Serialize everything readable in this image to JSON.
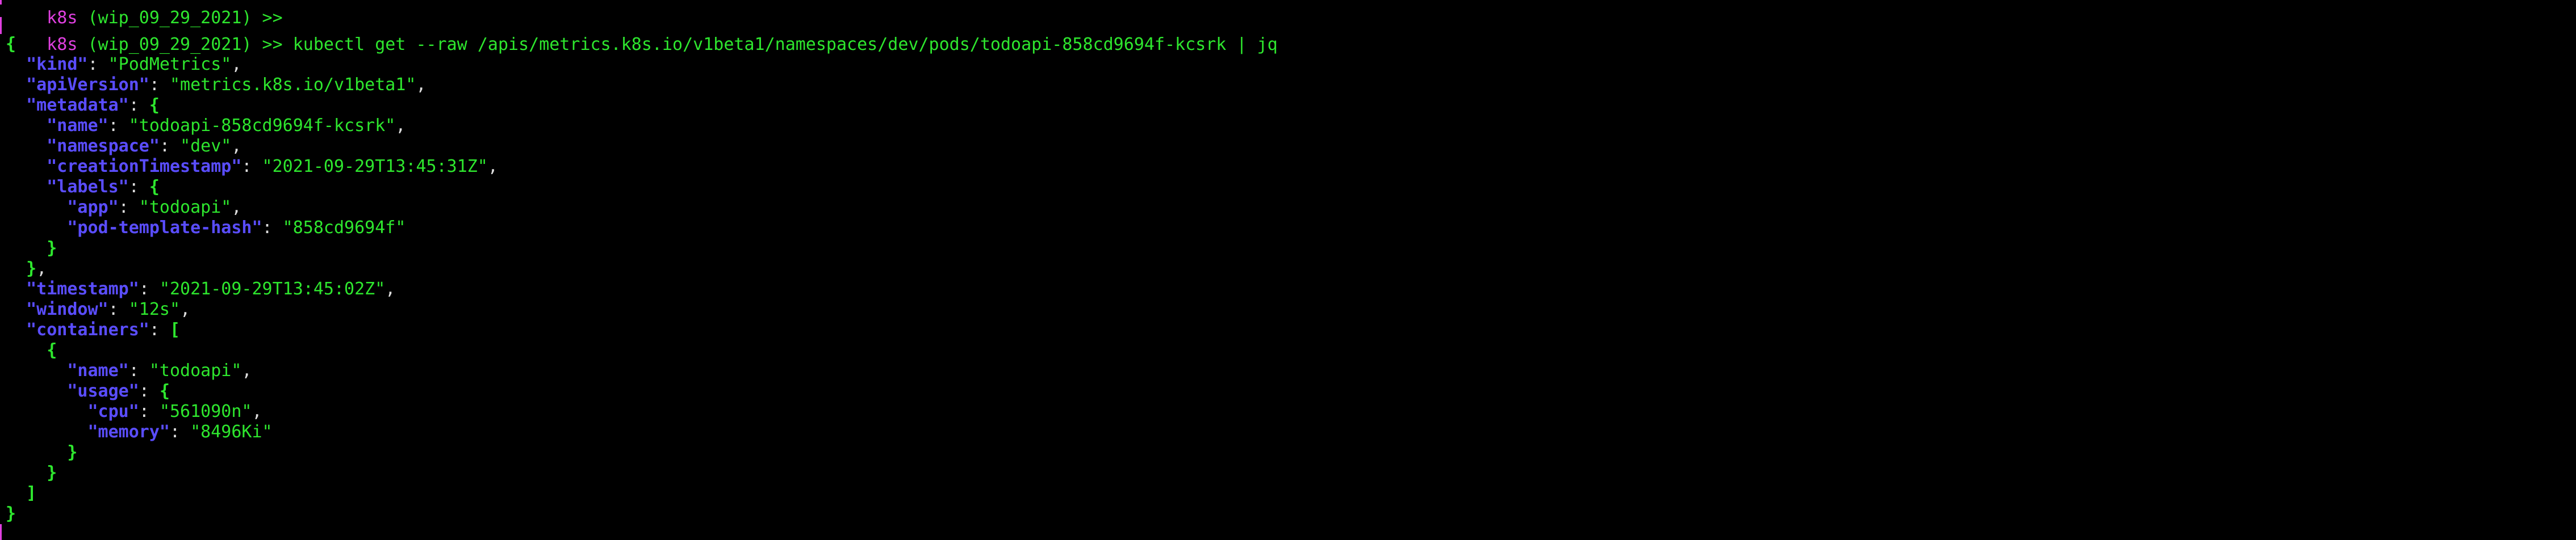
{
  "prompt": {
    "context": "k8s",
    "branch": "(wip_09_29_2021)",
    "symbol": ">>"
  },
  "command": "kubectl get --raw /apis/metrics.k8s.io/v1beta1/namespaces/dev/pods/todoapi-858cd9694f-kcsrk | jq",
  "output": {
    "open_brace": "{",
    "close_brace": "}",
    "kind_key": "\"kind\"",
    "kind_val": "\"PodMetrics\"",
    "apiVersion_key": "\"apiVersion\"",
    "apiVersion_val": "\"metrics.k8s.io/v1beta1\"",
    "metadata_key": "\"metadata\"",
    "name_key": "\"name\"",
    "name_val": "\"todoapi-858cd9694f-kcsrk\"",
    "namespace_key": "\"namespace\"",
    "namespace_val": "\"dev\"",
    "creationTimestamp_key": "\"creationTimestamp\"",
    "creationTimestamp_val": "\"2021-09-29T13:45:31Z\"",
    "labels_key": "\"labels\"",
    "app_key": "\"app\"",
    "app_val": "\"todoapi\"",
    "podTemplateHash_key": "\"pod-template-hash\"",
    "podTemplateHash_val": "\"858cd9694f\"",
    "timestamp_key": "\"timestamp\"",
    "timestamp_val": "\"2021-09-29T13:45:02Z\"",
    "window_key": "\"window\"",
    "window_val": "\"12s\"",
    "containers_key": "\"containers\"",
    "open_bracket": "[",
    "close_bracket": "]",
    "container_name_key": "\"name\"",
    "container_name_val": "\"todoapi\"",
    "usage_key": "\"usage\"",
    "cpu_key": "\"cpu\"",
    "cpu_val": "\"561090n\"",
    "memory_key": "\"memory\"",
    "memory_val": "\"8496Ki\""
  },
  "colors": {
    "background": "#000000",
    "context": "#e040e0",
    "text": "#2ee62e",
    "json_key": "#5a4dff",
    "punctuation": "#dddddd"
  }
}
